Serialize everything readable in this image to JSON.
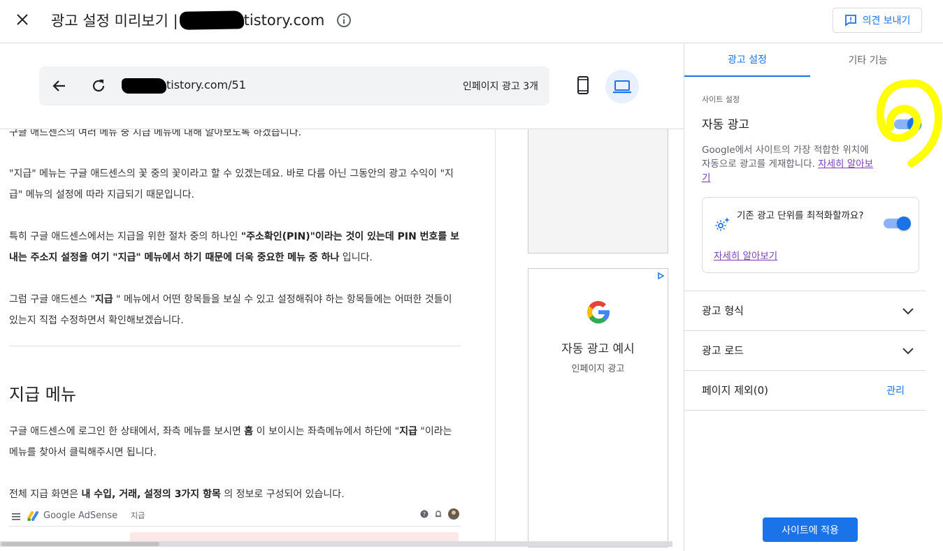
{
  "header": {
    "title_prefix": "광고 설정 미리보기 |",
    "title_suffix": "tistory.com",
    "feedback_label": "의견 보내기"
  },
  "preview": {
    "url_suffix": "tistory.com/51",
    "ad_count": "인페이지 광고 3개",
    "article": {
      "clipped_line": "구글 애드센스의 여러 메뉴 중 지급 메뉴에 대해 알아보도록 하겠습니다.",
      "p1": "\"지급\" 메뉴는 구글 애드센스의 꽃 중의 꽃이라고 할 수 있겠는데요. 바로 다름 아닌 그동안의 광고 수익이 \"지급\" 메뉴의 설정에 따라 지급되기 때문입니다.",
      "p2_a": "특히 구글 애드센스에서는 지급을 위한 절차 중의 하나인 ",
      "p2_b": "\"주소확인(PIN)\"이라는 것이 있는데 PIN 번호를 보내는 주소지 설정을 여기 \"지급\" 메뉴에서 하기 때문에 더욱 중요한 메뉴 중 하나",
      "p2_c": " 입니다.",
      "p3_a": "그럼 구글 애드센스 \"",
      "p3_b": "지급",
      "p3_c": " \" 메뉴에서 어떤 항목들을 보실 수 있고 설정해줘야 하는 항목들에는 어떠한 것들이 있는지 직접 수정하면서 확인해보겠습니다.",
      "heading": "지급 메뉴",
      "p4_a": "구글 애드센스에 로그인 한 상태에서, 좌측 메뉴를 보시면 ",
      "p4_b": "홈",
      "p4_c": " 이 보이시는 좌측메뉴에서 하단에 \"",
      "p4_d": "지급",
      "p4_e": " \"이라는 메뉴를 찾아서 클릭해주시면 됩니다.",
      "p5_a": "전체 지급 화면은 ",
      "p5_b": "내 수입, 거래, 설정의 3가지 항목",
      "p5_c": " 의 정보로 구성되어 있습니다."
    },
    "ad_example": {
      "title": "자동 광고 예시",
      "subtitle": "인페이지 광고"
    },
    "adsense_screenshot": {
      "brand": "Google AdSense",
      "page": "지급"
    }
  },
  "panel": {
    "tabs": [
      "광고 설정",
      "기타 기능"
    ],
    "site_settings_label": "사이트 설정",
    "auto_ads_title": "자동 광고",
    "auto_ads_on": true,
    "auto_ads_desc": "Google에서 사이트의 가장 적합한 위치에 자동으로 광고를 게재합니다. ",
    "learn_more": "자세히 알아보기",
    "optimize_text": "기존 광고 단위를 최적화할까요?",
    "optimize_on": true,
    "optimize_link": "자세히 알아보기",
    "rows": {
      "ad_format": "광고 형식",
      "ad_load": "광고 로드",
      "page_exclusion": "페이지 제외(0)",
      "manage": "관리"
    },
    "apply_label": "사이트에 적용"
  },
  "colors": {
    "accent": "#1a73e8",
    "link_visited": "#7b3fb8",
    "highlight": "#ffff00"
  }
}
